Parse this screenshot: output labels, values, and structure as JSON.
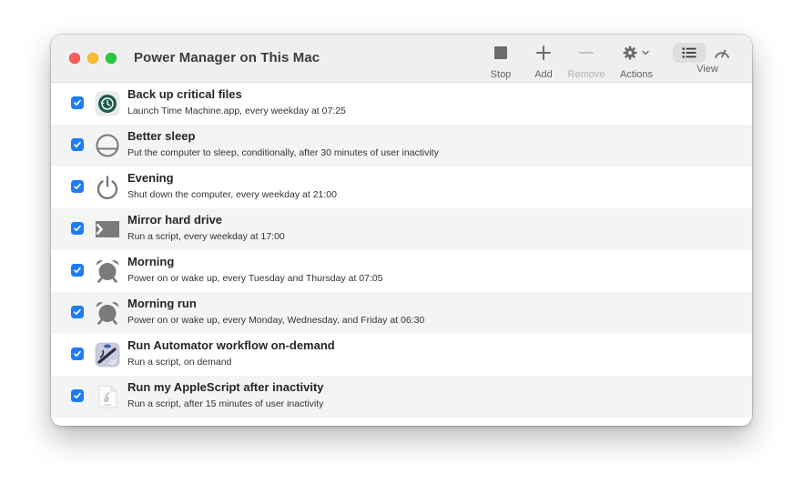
{
  "window": {
    "title": "Power Manager on This Mac"
  },
  "toolbar": {
    "items": [
      {
        "id": "stop",
        "label": "Stop",
        "icon": "stop-icon",
        "enabled": true
      },
      {
        "id": "add",
        "label": "Add",
        "icon": "plus-icon",
        "enabled": true
      },
      {
        "id": "remove",
        "label": "Remove",
        "icon": "minus-icon",
        "enabled": false
      },
      {
        "id": "actions",
        "label": "Actions",
        "icon": "gear-icon",
        "enabled": true
      },
      {
        "id": "view",
        "label": "View",
        "icons": [
          "list-icon",
          "gauge-icon"
        ],
        "selected": "list-icon",
        "enabled": true
      }
    ]
  },
  "events": [
    {
      "checked": true,
      "title": "Back up critical files",
      "subtitle": "Launch Time Machine.app, every weekday at 07:25",
      "icon": "time-machine-icon"
    },
    {
      "checked": true,
      "title": "Better sleep",
      "subtitle": "Put the computer to sleep, conditionally, after 30 minutes of user inactivity",
      "icon": "sleep-icon"
    },
    {
      "checked": true,
      "title": "Evening",
      "subtitle": "Shut down the computer, every weekday at 21:00",
      "icon": "power-icon"
    },
    {
      "checked": true,
      "title": "Mirror hard drive",
      "subtitle": "Run a script, every weekday at 17:00",
      "icon": "script-icon"
    },
    {
      "checked": true,
      "title": "Morning",
      "subtitle": "Power on or wake up, every Tuesday and Thursday at 07:05",
      "icon": "alarm-clock-icon"
    },
    {
      "checked": true,
      "title": "Morning run",
      "subtitle": "Power on or wake up, every Monday, Wednesday, and Friday at 06:30",
      "icon": "alarm-clock-icon"
    },
    {
      "checked": true,
      "title": "Run Automator workflow on-demand",
      "subtitle": "Run a script, on demand",
      "icon": "automator-icon"
    },
    {
      "checked": true,
      "title": "Run my AppleScript after inactivity",
      "subtitle": "Run a script, after 15 minutes of user inactivity",
      "icon": "applescript-file-icon"
    }
  ],
  "colors": {
    "accent": "#1e7cf5",
    "icon_gray": "#7a7a7a",
    "row_alt": "#f3f4f4"
  }
}
